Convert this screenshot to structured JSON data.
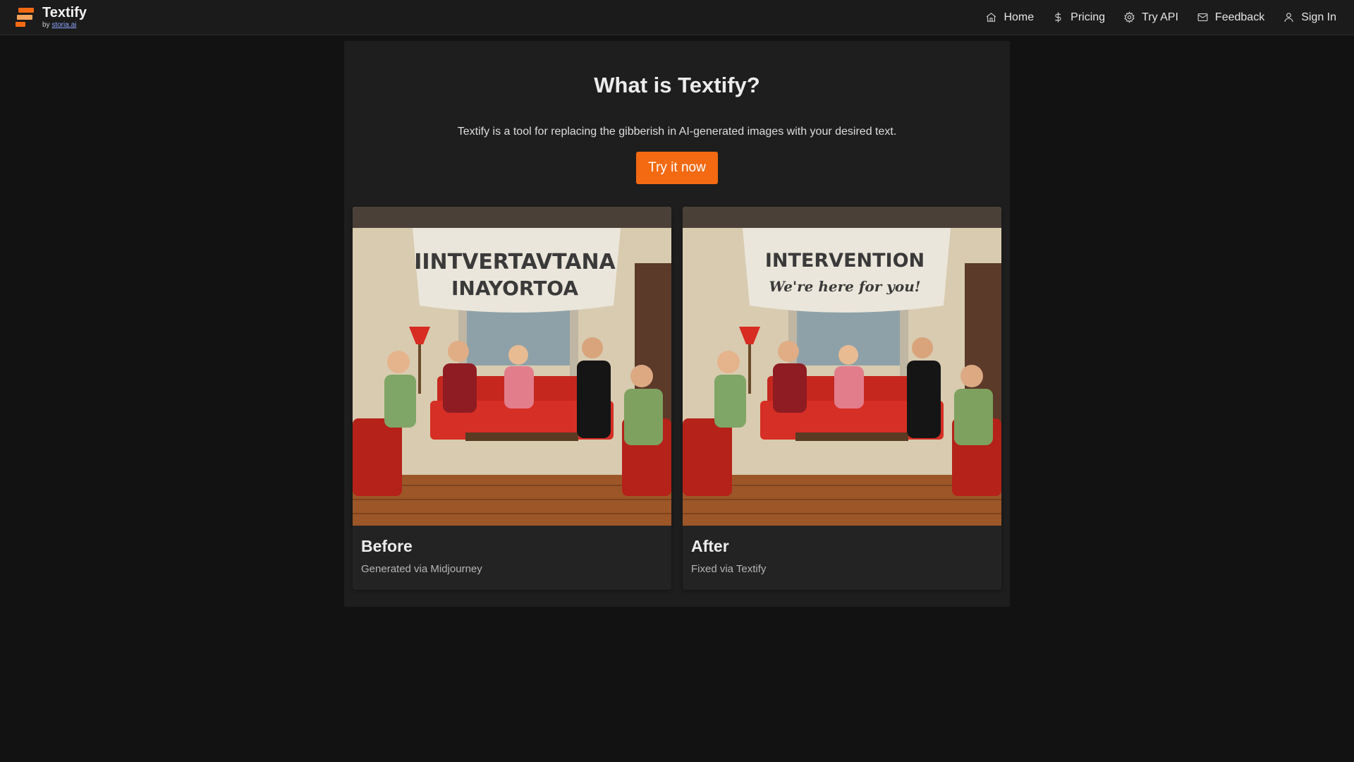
{
  "brand": {
    "name": "Textify",
    "by_prefix": "by",
    "by_link": "storia.ai",
    "accent": "#f36a12"
  },
  "nav": {
    "items": [
      {
        "label": "Home",
        "icon": "home-icon"
      },
      {
        "label": "Pricing",
        "icon": "dollar-icon"
      },
      {
        "label": "Try API",
        "icon": "gear-icon"
      },
      {
        "label": "Feedback",
        "icon": "mail-icon"
      },
      {
        "label": "Sign In",
        "icon": "user-icon"
      }
    ]
  },
  "hero": {
    "title": "What is Textify?",
    "subtitle": "Textify is a tool for replacing the gibberish in AI-generated images with your desired text.",
    "cta": "Try it now"
  },
  "examples": {
    "before": {
      "title": "Before",
      "caption": "Generated via Midjourney",
      "banner_line1": "IINTVERTAVTANA",
      "banner_line2": "INAYORTOA"
    },
    "after": {
      "title": "After",
      "caption": "Fixed via Textify",
      "banner_line1": "INTERVENTION",
      "banner_line2": "We're here for you!"
    }
  }
}
